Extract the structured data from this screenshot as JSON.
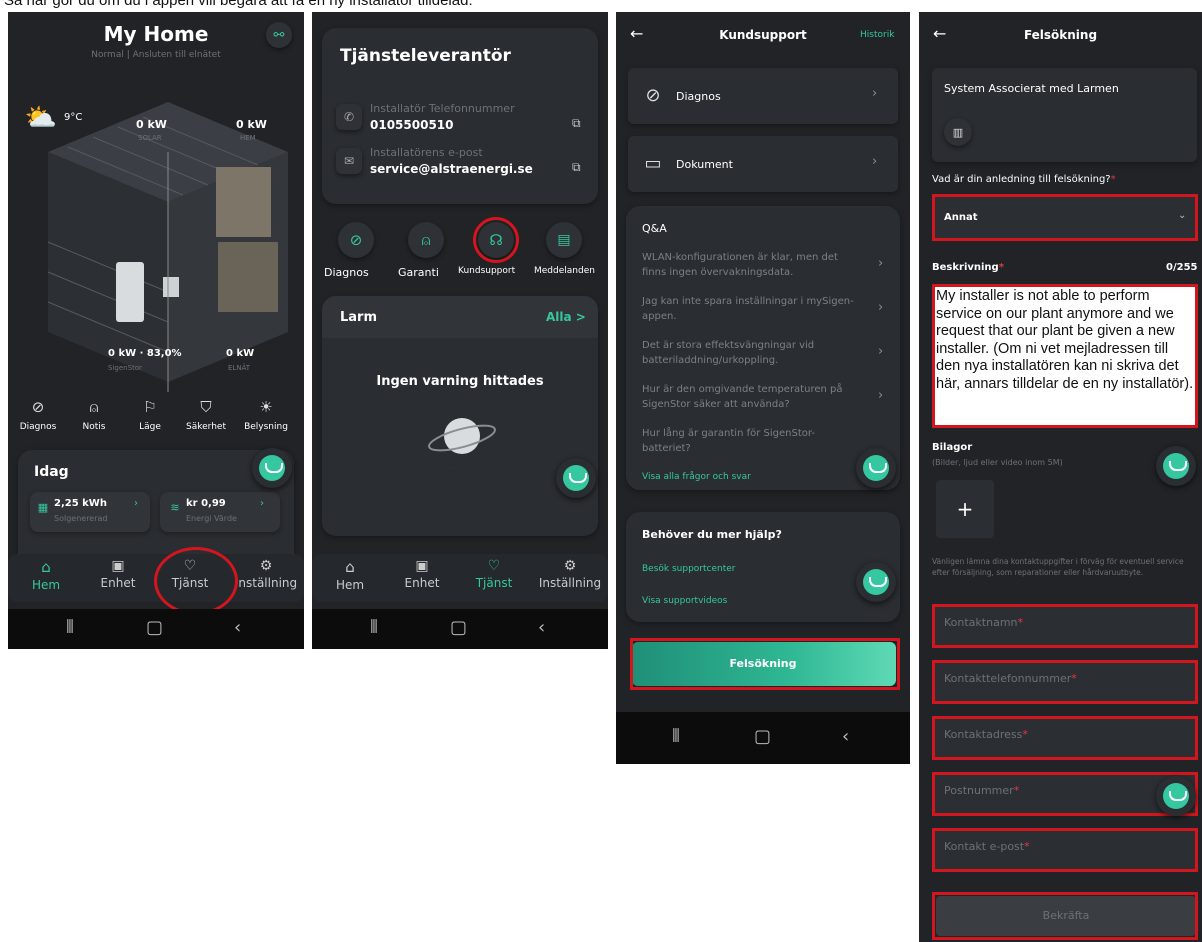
{
  "page_top_text": "Så här gör du om du i appen vill begära att få en ny installatör tilldelad:",
  "p1": {
    "title": "My Home",
    "subtitle": "Normal | Ansluten till elnätet",
    "weather_temp": "9°C",
    "solar_kw": "0 kW",
    "solar_label": "SOLAR",
    "home_kw": "0 kW",
    "home_label": "HEM",
    "sigen_kw": "0 kW · 83,0%",
    "sigen_label": "SigenStor",
    "grid_kw": "0 kW",
    "grid_label": "ELNÄT",
    "quick_actions": [
      "Diagnos",
      "Notis",
      "Läge",
      "Säkerhet",
      "Belysning"
    ],
    "today_title": "Idag",
    "stat1_value": "2,25 kWh",
    "stat1_label": "Solgenererad",
    "stat2_value": "kr 0,99",
    "stat2_label": "Energi Värde",
    "nav": [
      "Hem",
      "Enhet",
      "Tjänst",
      "Inställning"
    ]
  },
  "p2": {
    "title": "Tjänsteleverantör",
    "phone_label": "Installatör Telefonnummer",
    "phone_value": "0105500510",
    "email_label": "Installatörens e-post",
    "email_value": "service@alstraenergi.se",
    "actions": [
      "Diagnos",
      "Garanti",
      "Kundsupport",
      "Meddelanden"
    ],
    "alarm_title": "Larm",
    "alarm_all": "Alla >",
    "no_alarm": "Ingen varning hittades",
    "nav": [
      "Hem",
      "Enhet",
      "Tjänst",
      "Inställning"
    ]
  },
  "p3": {
    "title": "Kundsupport",
    "history": "Historik",
    "row1": "Diagnos",
    "row2": "Dokument",
    "qa_title": "Q&A",
    "questions": [
      "WLAN-konfigurationen är klar, men det finns ingen övervakningsdata.",
      "Jag kan inte spara inställningar i mySigen-appen.",
      "Det är stora effektsvängningar vid batteriladdning/urkoppling.",
      "Hur är den omgivande temperaturen på SigenStor säker att använda?",
      "Hur lång är garantin för SigenStor-batteriet?"
    ],
    "show_all_qa": "Visa alla frågor och svar",
    "help_title": "Behöver du mer hjälp?",
    "help_link1": "Besök supportcenter",
    "help_link2": "Visa supportvideos",
    "troubleshoot_button": "Felsökning"
  },
  "p4": {
    "title": "Felsökning",
    "system_label": "System Associerat med Larmen",
    "reason_label": "Vad är din anledning till felsökning?",
    "reason_value": "Annat",
    "desc_label": "Beskrivning",
    "desc_count": "0/255",
    "desc_text": "My installer is not able to perform service on our plant anymore and we request that our plant be given a new installer. (Om ni vet mejladressen till den nya installatören kan ni skriva det här, annars tilldelar de en ny installatör).",
    "attach_label": "Bilagor",
    "attach_hint": "(Bilder, ljud eller video inom 5M)",
    "contact_note": "Vänligen lämna dina kontaktuppgifter i förväg för eventuell service efter försäljning, som reparationer eller hårdvaruutbyte.",
    "fields": [
      "Kontaktnamn",
      "Kontakttelefonnummer",
      "Kontaktadress",
      "Postnummer",
      "Kontakt e-post"
    ],
    "confirm_button": "Bekräfta"
  },
  "colors": {
    "accent": "#35c8a0",
    "highlight": "#d2161d",
    "background": "#212327"
  }
}
